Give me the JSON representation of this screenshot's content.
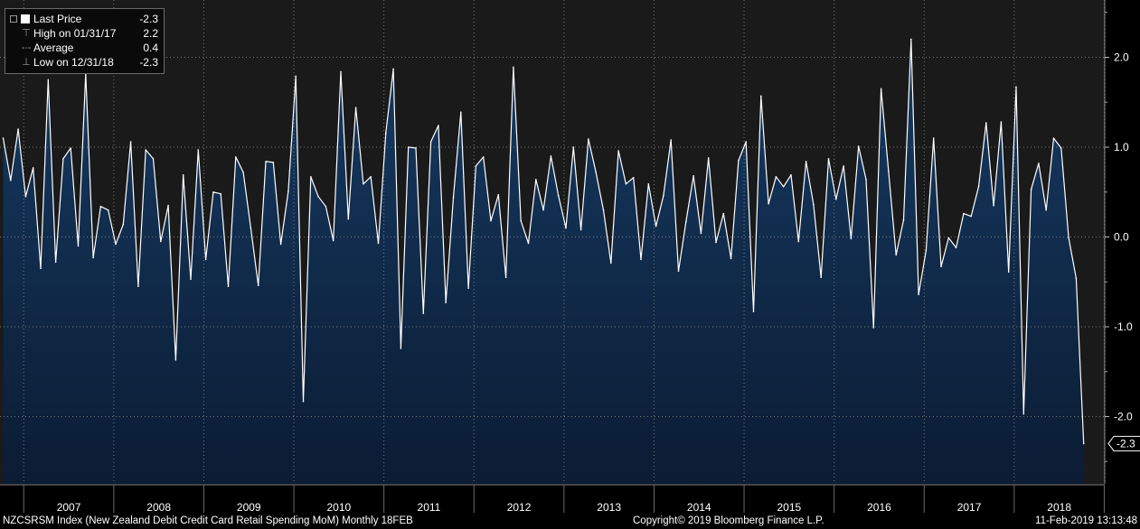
{
  "legend": {
    "last": {
      "label": "Last Price",
      "value": "-2.3"
    },
    "high": {
      "label": "High on 01/31/17",
      "value": "2.2"
    },
    "avg": {
      "label": "Average",
      "value": "0.4"
    },
    "low": {
      "label": "Low on 12/31/18",
      "value": "-2.3"
    }
  },
  "last_marker": "-2.3",
  "footer": {
    "left": "NZCSRSM Index (New Zealand Debit Credit Card Retail Spending MoM)  Monthly 18FEB",
    "center": "Copyright© 2019 Bloomberg Finance L.P.",
    "right": "11-Feb-2019 13:13:48"
  },
  "colors": {
    "line": "#ffffff",
    "area_top": "#163a63",
    "area_bottom": "#0b1c33",
    "plot_bg": "#1a1a1a",
    "axis_bg": "#000000"
  },
  "chart_data": {
    "type": "area",
    "title": "",
    "xlabel": "",
    "ylabel": "",
    "ylim": [
      -2.7,
      2.6
    ],
    "yticks": [
      2.0,
      1.0,
      0.0,
      -1.0,
      -2.0
    ],
    "ytick_labels": [
      "2.0",
      "1.0",
      "0.0",
      "-1.0",
      "-2.0"
    ],
    "x_start": "2006-10",
    "frequency": "monthly",
    "year_labels": [
      "2007",
      "2008",
      "2009",
      "2010",
      "2011",
      "2012",
      "2013",
      "2014",
      "2015",
      "2016",
      "2017",
      "2018"
    ],
    "series": [
      {
        "values": [
          1.1,
          0.63,
          1.2,
          0.45,
          0.77,
          -0.35,
          1.75,
          -0.28,
          0.87,
          0.99,
          -0.1,
          1.82,
          -0.23,
          0.34,
          0.3,
          -0.08,
          0.14,
          1.06,
          -0.55,
          0.97,
          0.87,
          -0.05,
          0.35,
          -1.37,
          0.69,
          -0.47,
          0.97,
          -0.25,
          0.5,
          0.48,
          -0.55,
          0.89,
          0.72,
          0.1,
          -0.54,
          0.84,
          0.83,
          -0.08,
          0.51,
          1.79,
          -1.83,
          0.67,
          0.45,
          0.34,
          -0.04,
          1.84,
          0.2,
          1.44,
          0.59,
          0.67,
          -0.07,
          1.16,
          1.87,
          -1.24,
          1.0,
          0.99,
          -0.85,
          1.06,
          1.24,
          -0.73,
          0.44,
          1.39,
          -0.57,
          0.79,
          0.89,
          0.18,
          0.47,
          -0.45,
          1.89,
          0.18,
          -0.07,
          0.64,
          0.3,
          0.9,
          0.46,
          0.1,
          1.0,
          0.08,
          1.09,
          0.72,
          0.3,
          -0.29,
          0.96,
          0.59,
          0.66,
          -0.25,
          0.59,
          0.12,
          0.46,
          1.08,
          -0.38,
          0.17,
          0.68,
          0.04,
          0.88,
          -0.06,
          0.26,
          -0.24,
          0.85,
          1.06,
          -0.83,
          1.57,
          0.37,
          0.67,
          0.56,
          0.69,
          -0.05,
          0.84,
          0.36,
          -0.45,
          0.87,
          0.42,
          0.79,
          -0.02,
          1.01,
          0.64,
          -1.01,
          1.65,
          0.73,
          -0.2,
          0.19,
          2.2,
          -0.64,
          -0.15,
          1.1,
          -0.33,
          -0.01,
          -0.12,
          0.26,
          0.23,
          0.56,
          1.27,
          0.35,
          1.28,
          -0.39,
          1.67,
          -1.97,
          0.53,
          0.82,
          0.3,
          1.1,
          0.99,
          -0.01,
          -0.46,
          -2.3
        ]
      }
    ]
  }
}
